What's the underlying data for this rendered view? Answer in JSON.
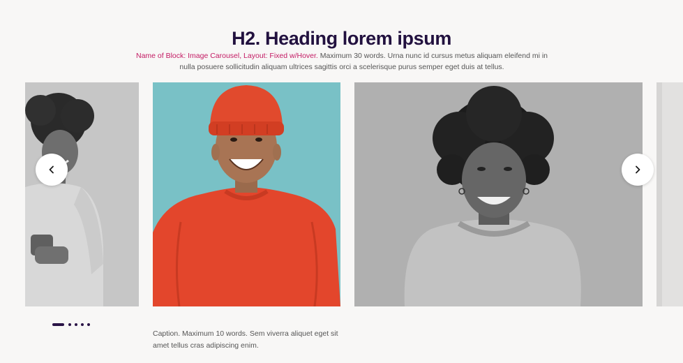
{
  "section": {
    "heading": "H2. Heading lorem ipsum",
    "intro_highlight": "Name of Block: Image Carousel, Layout: Fixed w/Hover.",
    "intro_text": " Maximum 30 words. Urna nunc id cursus metus aliquam eleifend mi in nulla posuere sollicitudin aliquam ultrices sagittis orci a scelerisque purus semper eget duis at tellus."
  },
  "carousel": {
    "slides": [
      {
        "name": "woman-with-phone-photo",
        "style": "grayscale"
      },
      {
        "name": "man-in-red-beanie-photo",
        "style": "color"
      },
      {
        "name": "woman-curly-hair-photo",
        "style": "grayscale"
      },
      {
        "name": "next-slide-peek",
        "style": "grayscale"
      }
    ],
    "prev_icon": "chevron-left-icon",
    "next_icon": "chevron-right-icon",
    "dot_count": 5,
    "active_dot": 1,
    "caption": "Caption. Maximum 10 words. Sem viverra aliquet eget sit amet tellus cras adipiscing enim."
  },
  "colors": {
    "heading": "#22113f",
    "highlight": "#c31a63",
    "background": "#f8f7f6",
    "photo_teal": "#79c1c6",
    "beanie_red": "#e0452b"
  }
}
